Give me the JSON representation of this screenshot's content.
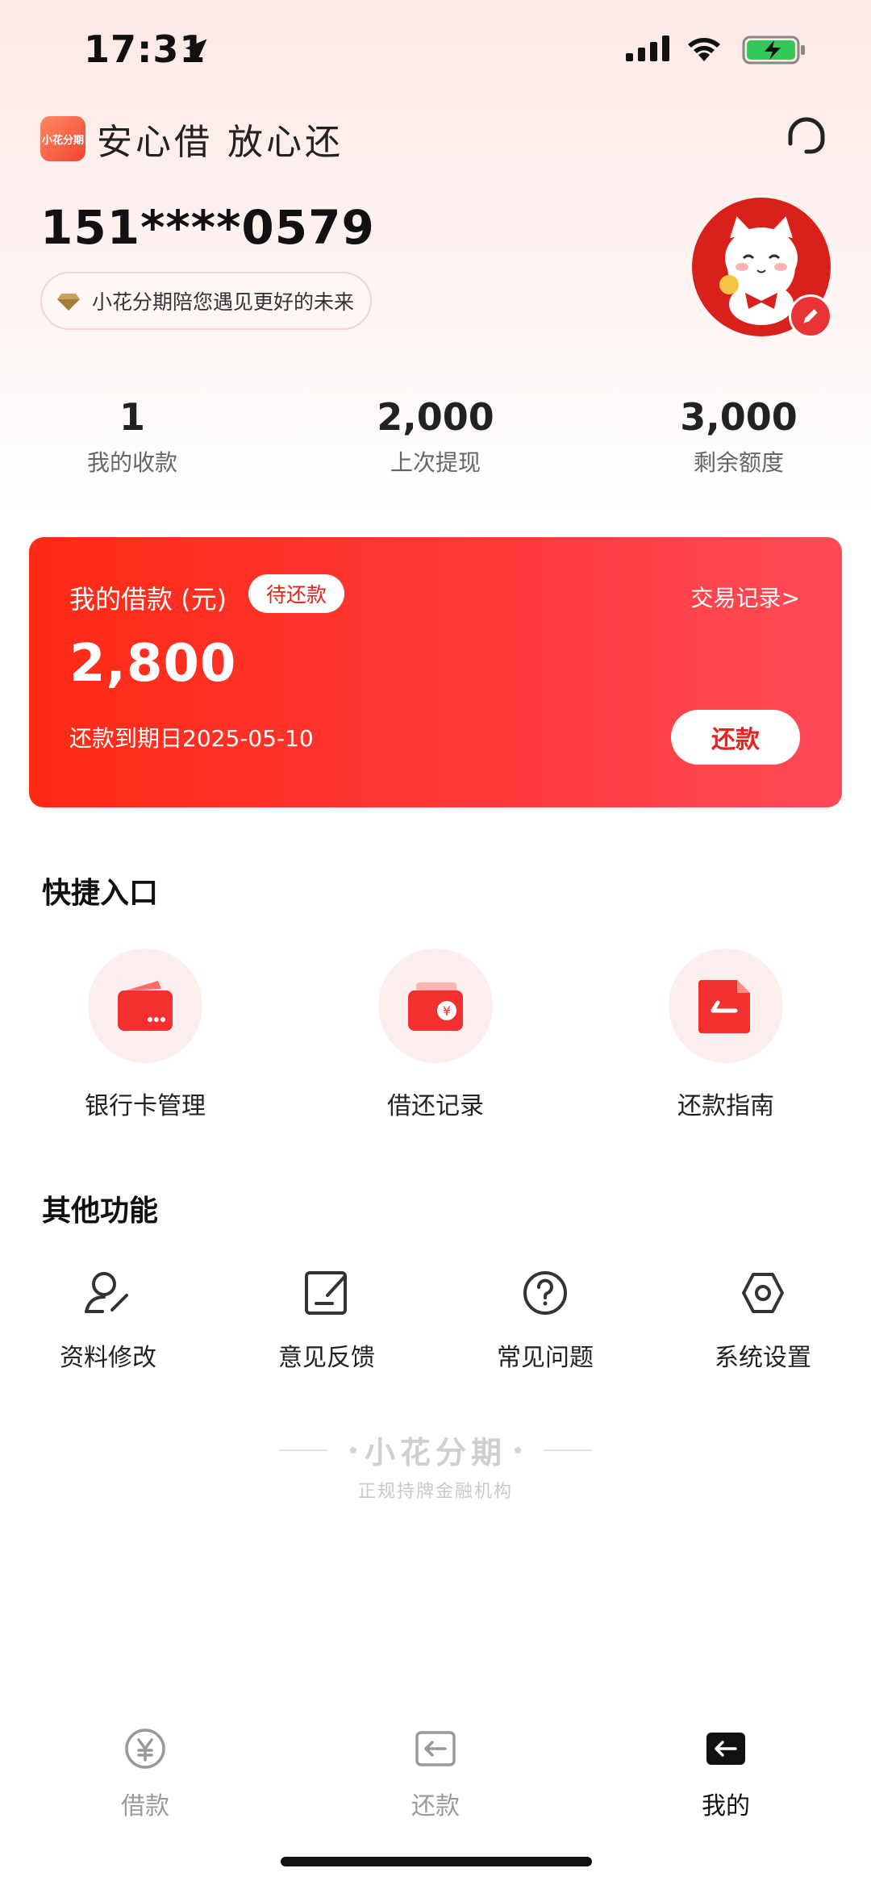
{
  "status_bar": {
    "time": "17:31"
  },
  "header": {
    "logo_text": "小花分期",
    "slogan": "安心借 放心还",
    "support_icon": "customer-service-icon"
  },
  "profile": {
    "phone": "151****0579",
    "tagline": "小花分期陪您遇见更好的未来"
  },
  "stats": [
    {
      "value": "1",
      "label": "我的收款"
    },
    {
      "value": "2,000",
      "label": "上次提现"
    },
    {
      "value": "3,000",
      "label": "剩余额度"
    }
  ],
  "loan_card": {
    "title": "我的借款 (元)",
    "status": "待还款",
    "records_link": "交易记录>",
    "amount": "2,800",
    "due": "还款到期日2025-05-10",
    "repay_button": "还款"
  },
  "quick_entry": {
    "title": "快捷入口",
    "items": [
      {
        "label": "银行卡管理",
        "icon": "bank-card-icon"
      },
      {
        "label": "借还记录",
        "icon": "wallet-icon"
      },
      {
        "label": "还款指南",
        "icon": "guide-icon"
      }
    ]
  },
  "other_functions": {
    "title": "其他功能",
    "items": [
      {
        "label": "资料修改",
        "icon": "edit-profile-icon"
      },
      {
        "label": "意见反馈",
        "icon": "feedback-icon"
      },
      {
        "label": "常见问题",
        "icon": "help-icon"
      },
      {
        "label": "系统设置",
        "icon": "settings-icon"
      }
    ]
  },
  "footer": {
    "brand": "小花分期",
    "subtitle": "正规持牌金融机构"
  },
  "tab_bar": [
    {
      "label": "借款",
      "icon": "yuan-icon",
      "active": false
    },
    {
      "label": "还款",
      "icon": "repay-icon",
      "active": false
    },
    {
      "label": "我的",
      "icon": "mine-icon",
      "active": true
    }
  ],
  "colors": {
    "accent": "#ff2a14",
    "card_end": "#ff4b58"
  }
}
